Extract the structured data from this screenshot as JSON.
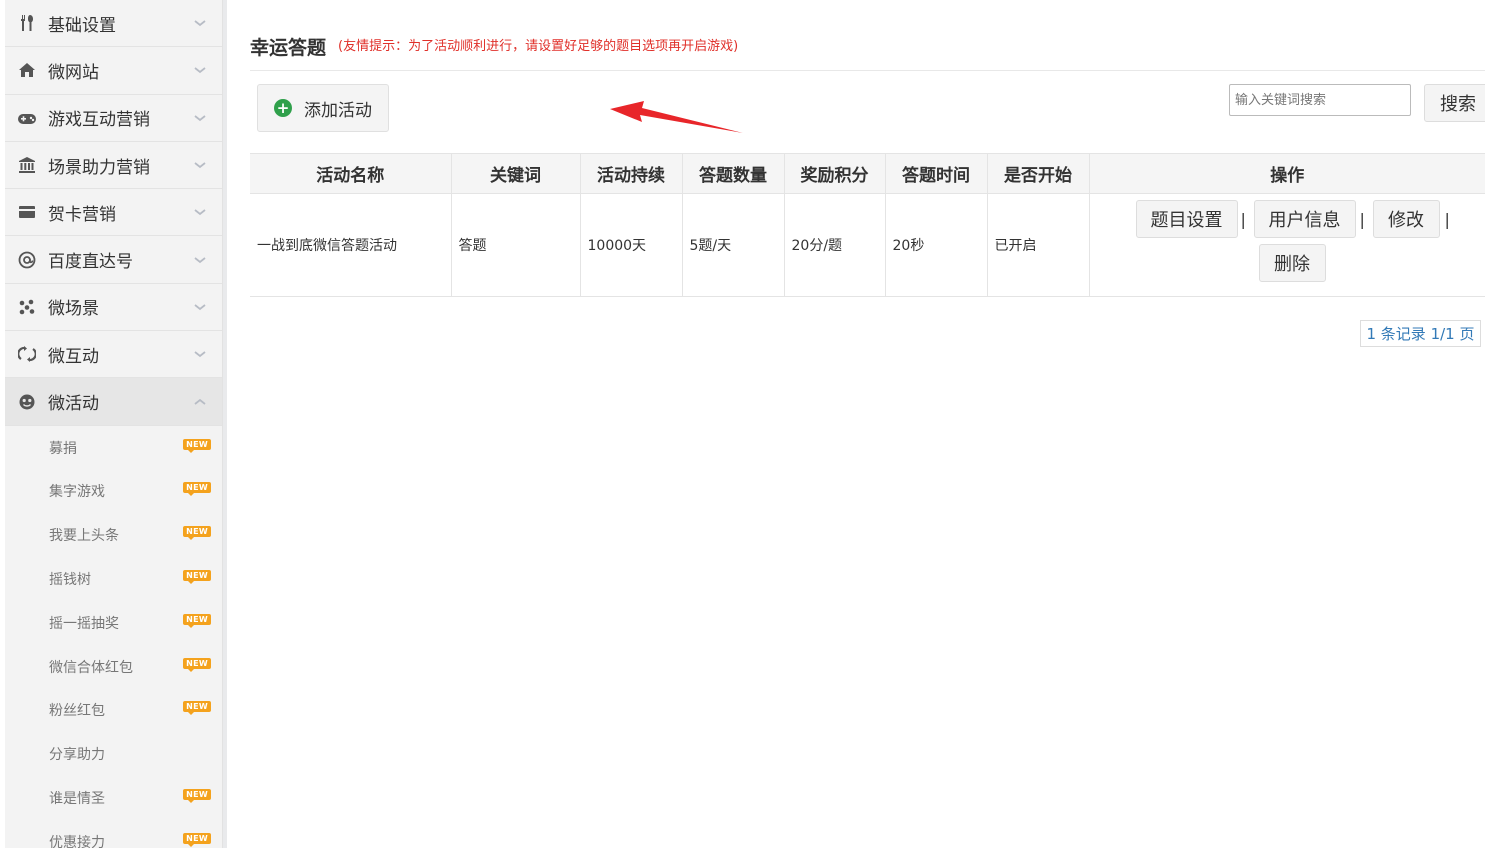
{
  "sidebar": {
    "menus": [
      {
        "label": "基础设置",
        "icon": "tools-icon"
      },
      {
        "label": "微网站",
        "icon": "home-icon"
      },
      {
        "label": "游戏互动营销",
        "icon": "gamepad-icon"
      },
      {
        "label": "场景助力营销",
        "icon": "bank-icon"
      },
      {
        "label": "贺卡营销",
        "icon": "card-icon"
      },
      {
        "label": "百度直达号",
        "icon": "at-icon"
      },
      {
        "label": "微场景",
        "icon": "scenes-icon"
      },
      {
        "label": "微互动",
        "icon": "interact-icon"
      },
      {
        "label": "微活动",
        "icon": "activity-icon"
      }
    ],
    "submenu": [
      {
        "label": "募捐",
        "badge": "NEW"
      },
      {
        "label": "集字游戏",
        "badge": "NEW"
      },
      {
        "label": "我要上头条",
        "badge": "NEW"
      },
      {
        "label": "摇钱树",
        "badge": "NEW"
      },
      {
        "label": "摇一摇抽奖",
        "badge": "NEW"
      },
      {
        "label": "微信合体红包",
        "badge": "NEW"
      },
      {
        "label": "粉丝红包",
        "badge": "NEW"
      },
      {
        "label": "分享助力",
        "badge": ""
      },
      {
        "label": "谁是情圣",
        "badge": "NEW"
      },
      {
        "label": "优惠接力",
        "badge": "NEW"
      }
    ]
  },
  "header": {
    "title": "幸运答题",
    "tip": "(友情提示：为了活动顺利进行，请设置好足够的题目选项再开启游戏)"
  },
  "toolbar": {
    "add_label": "添加活动",
    "search_placeholder": "输入关键词搜索",
    "search_label": "搜索"
  },
  "table": {
    "columns": [
      "活动名称",
      "关键词",
      "活动持续",
      "答题数量",
      "奖励积分",
      "答题时间",
      "是否开始",
      "操作"
    ],
    "rows": [
      {
        "cells": [
          "一战到底微信答题活动",
          "答题",
          "10000天",
          "5题/天",
          "20分/题",
          "20秒",
          "已开启"
        ],
        "actions": {
          "questions": "题目设置",
          "users": "用户信息",
          "edit": "修改",
          "delete": "删除",
          "sep": "|"
        }
      }
    ]
  },
  "pager": {
    "text": "1 条记录 1/1 页"
  },
  "colors": {
    "tip": "#e0302a",
    "badge": "#f4a21d",
    "add_icon": "#2fa04b",
    "annotation_arrow": "#e8262a",
    "pager_link": "#337ab7"
  }
}
